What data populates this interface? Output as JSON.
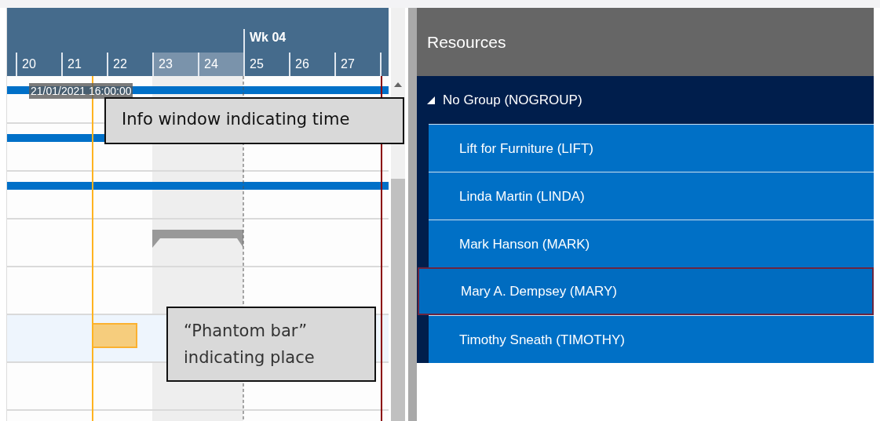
{
  "timeline": {
    "days": [
      {
        "label": "20",
        "weekend": false
      },
      {
        "label": "21",
        "weekend": false
      },
      {
        "label": "22",
        "weekend": false
      },
      {
        "label": "23",
        "weekend": true
      },
      {
        "label": "24",
        "weekend": true
      },
      {
        "label": "25",
        "weekend": false,
        "week_label": "Wk 04"
      },
      {
        "label": "26",
        "weekend": false
      },
      {
        "label": "27",
        "weekend": false
      }
    ],
    "rows": [
      {
        "kind": "booking",
        "highlighted": false
      },
      {
        "kind": "booking",
        "highlighted": false
      },
      {
        "kind": "booking",
        "highlighted": false
      },
      {
        "kind": "weekend_marker",
        "highlighted": false
      },
      {
        "kind": "empty",
        "highlighted": false
      },
      {
        "kind": "phantom",
        "highlighted": true
      },
      {
        "kind": "empty",
        "highlighted": false
      },
      {
        "kind": "empty",
        "highlighted": false
      }
    ],
    "time_tooltip": "21/01/2021 16:00:00"
  },
  "callouts": [
    {
      "text": "Info window indicating time"
    },
    {
      "text": "“Phantom bar” indicating place"
    }
  ],
  "resources": {
    "title": "Resources",
    "group": {
      "label": "No Group (NOGROUP)",
      "expanded": true,
      "children": [
        {
          "label": "Lift for Furniture (LIFT)",
          "selected": false
        },
        {
          "label": "Linda Martin (LINDA)",
          "selected": false
        },
        {
          "label": "Mark Hanson (MARK)",
          "selected": false
        },
        {
          "label": "Mary A. Dempsey (MARY)",
          "selected": true
        },
        {
          "label": "Timothy Sneath (TIMOTHY)",
          "selected": false
        }
      ]
    }
  }
}
